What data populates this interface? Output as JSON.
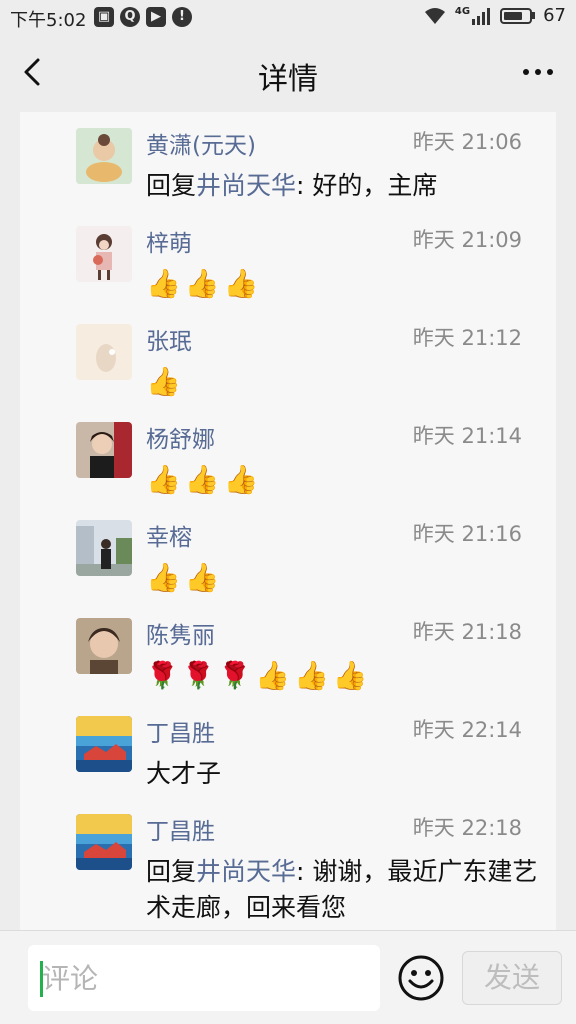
{
  "status_bar": {
    "time": "下午5:02",
    "network": "4G",
    "battery": "67"
  },
  "header": {
    "title": "详情",
    "back_icon": "chevron-left-icon",
    "more_icon": "more-horizontal-icon"
  },
  "comments": [
    {
      "name": "黄潇(元天)",
      "time": "昨天 21:06",
      "reply_prefix": "回复",
      "reply_to": "井尚天华",
      "text": ": 好的，主席",
      "emojis": []
    },
    {
      "name": "梓萌",
      "time": "昨天 21:09",
      "emojis": [
        "👍",
        "👍",
        "👍"
      ]
    },
    {
      "name": "张珉",
      "time": "昨天 21:12",
      "emojis": [
        "👍"
      ]
    },
    {
      "name": "杨舒娜",
      "time": "昨天 21:14",
      "emojis": [
        "👍",
        "👍",
        "👍"
      ]
    },
    {
      "name": "幸榕",
      "time": "昨天 21:16",
      "emojis": [
        "👍",
        "👍"
      ]
    },
    {
      "name": "陈隽丽",
      "time": "昨天 21:18",
      "emojis": [
        "🌹",
        "🌹",
        "🌹",
        "👍",
        "👍",
        "👍"
      ]
    },
    {
      "name": "丁昌胜",
      "time": "昨天 22:14",
      "text": "大才子"
    },
    {
      "name": "丁昌胜",
      "time": "昨天 22:18",
      "reply_prefix": "回复",
      "reply_to": "井尚天华",
      "text": ": 谢谢，最近广东建艺术走廊，回来看您"
    }
  ],
  "input": {
    "placeholder": "评论",
    "send_label": "发送",
    "emoji_icon": "smiley-icon"
  }
}
